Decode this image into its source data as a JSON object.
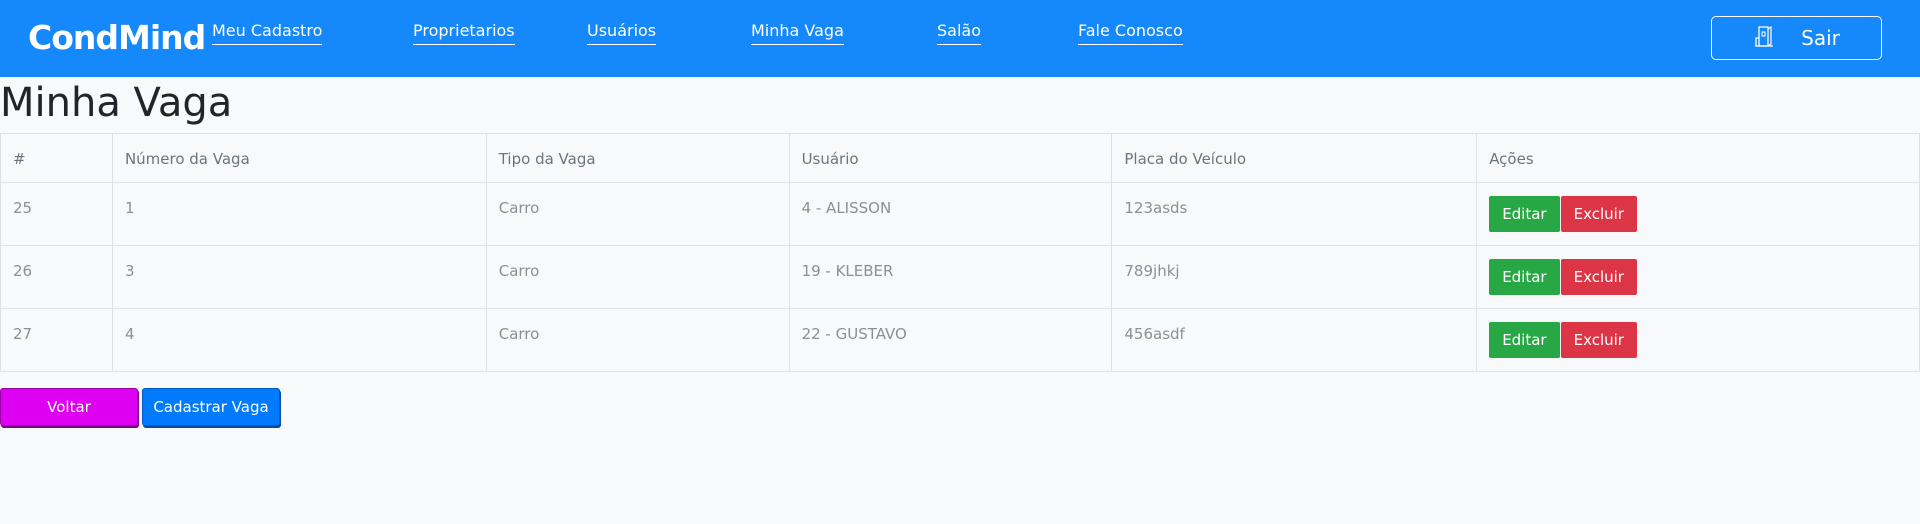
{
  "brand": {
    "logo_text": "CondMind"
  },
  "nav": {
    "links": [
      {
        "label": "Meu Cadastro"
      },
      {
        "label": "Proprietarios"
      },
      {
        "label": "Usuários"
      },
      {
        "label": "Minha Vaga"
      },
      {
        "label": "Salão"
      },
      {
        "label": "Fale Conosco"
      }
    ],
    "logout_label": "Sair",
    "logout_icon": "building-door-icon"
  },
  "page": {
    "title": "Minha Vaga"
  },
  "table": {
    "headers": [
      "#",
      "Número da Vaga",
      "Tipo da Vaga",
      "Usuário",
      "Placa do Veículo",
      "Ações"
    ],
    "rows": [
      {
        "id": "25",
        "numero": "1",
        "tipo": "Carro",
        "usuario": "4 - ALISSON",
        "placa": "123asds"
      },
      {
        "id": "26",
        "numero": "3",
        "tipo": "Carro",
        "usuario": "19 - KLEBER",
        "placa": "789jhkj"
      },
      {
        "id": "27",
        "numero": "4",
        "tipo": "Carro",
        "usuario": "22 - GUSTAVO",
        "placa": "456asdf"
      }
    ],
    "edit_label": "Editar",
    "delete_label": "Excluir"
  },
  "actions": {
    "back_label": "Voltar",
    "register_label": "Cadastrar Vaga"
  },
  "colors": {
    "navbar": "#1588fb",
    "edit": "#28a745",
    "delete": "#dc3545",
    "back": "#dd00f1",
    "register": "#007bff"
  }
}
